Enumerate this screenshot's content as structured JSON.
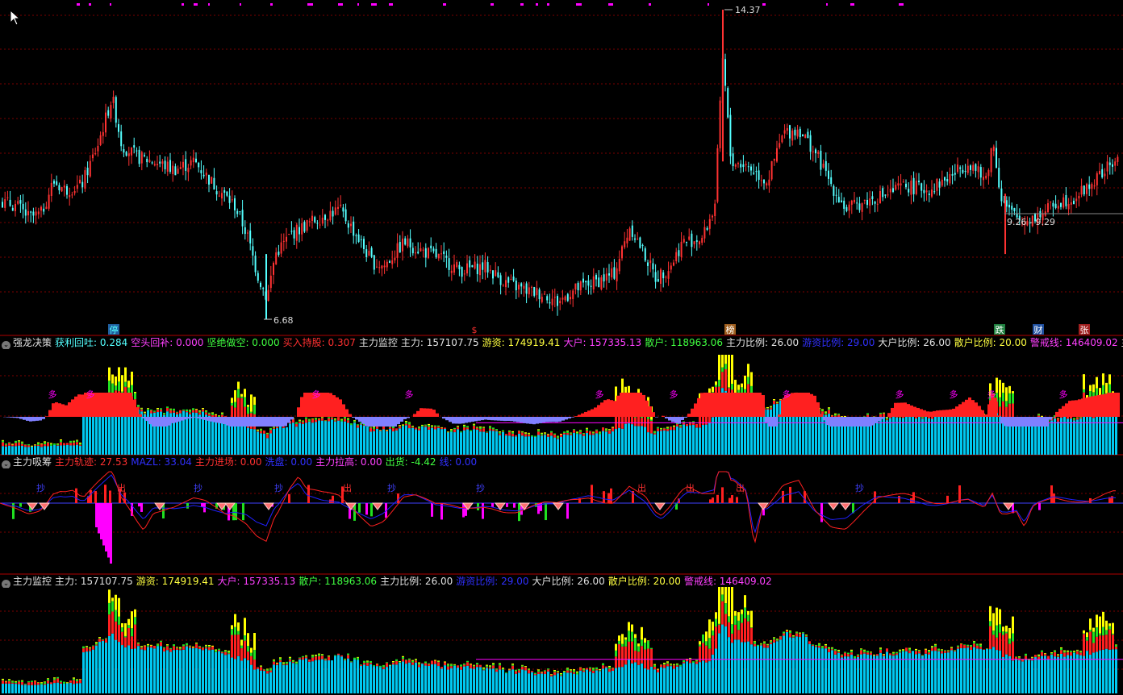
{
  "colors": {
    "up": "#ff3232",
    "down": "#54ffff",
    "grid": "#7a0000",
    "panel_border": "#b00000",
    "cyan_bar": "#00c8f0",
    "red_bar": "#ff2020",
    "green_bar": "#20e020",
    "yellow_bar": "#ffff00",
    "purple": "#8080ff",
    "magenta": "#ff00ff",
    "blue_line": "#2020ff",
    "red_line": "#ff2020"
  },
  "price_panel": {
    "high_label": "14.37",
    "low_label": "6.68",
    "range_label": "9.26 - 9.29",
    "markers": [
      {
        "label": "停",
        "color": "#2060a0",
        "text": "#54ffff"
      },
      {
        "label": "$",
        "color": "#000000",
        "text": "#ff3030"
      },
      {
        "label": "榜",
        "color": "#a06020",
        "text": "#ffffff"
      },
      {
        "label": "跌",
        "color": "#208040",
        "text": "#ffffff"
      },
      {
        "label": "财",
        "color": "#2050a0",
        "text": "#ffffff"
      },
      {
        "label": "张",
        "color": "#a02020",
        "text": "#ffffff"
      }
    ]
  },
  "panel1": {
    "name": "强龙决策",
    "items": [
      {
        "label": "获利回吐:",
        "value": "0.284",
        "color": "#54ffff"
      },
      {
        "label": "空头回补:",
        "value": "0.000",
        "color": "#ff40ff"
      },
      {
        "label": "坚绝做空:",
        "value": "0.000",
        "color": "#40ff40"
      },
      {
        "label": "买入持股:",
        "value": "0.307",
        "color": "#ff3030"
      },
      {
        "label": "主力监控",
        "value": "",
        "color": "#e0e0e0"
      },
      {
        "label": "主力:",
        "value": "157107.75",
        "color": "#e0e0e0"
      },
      {
        "label": "游资:",
        "value": "174919.41",
        "color": "#ffff40"
      },
      {
        "label": "大户:",
        "value": "157335.13",
        "color": "#ff40ff"
      },
      {
        "label": "散户:",
        "value": "118963.06",
        "color": "#40ff40"
      },
      {
        "label": "主力比例:",
        "value": "26.00",
        "color": "#e0e0e0"
      },
      {
        "label": "游资比例:",
        "value": "29.00",
        "color": "#3030ff"
      },
      {
        "label": "大户比例:",
        "value": "26.00",
        "color": "#e0e0e0"
      },
      {
        "label": "散户比例:",
        "value": "20.00",
        "color": "#ffff40"
      },
      {
        "label": "警戒线:",
        "value": "146409.02",
        "color": "#ff40ff"
      },
      {
        "label": "主力监控",
        "value": "",
        "color": "#e0e0e0"
      },
      {
        "label": "主力",
        "value": "",
        "color": "#e0e0e0"
      }
    ],
    "duo_label": "多"
  },
  "panel2": {
    "name": "主力吸筹",
    "items": [
      {
        "label": "主力轨迹:",
        "value": "27.53",
        "color": "#ff3030"
      },
      {
        "label": "MAZL:",
        "value": "33.04",
        "color": "#3030ff"
      },
      {
        "label": "主力进场:",
        "value": "0.00",
        "color": "#ff3030"
      },
      {
        "label": "洗盘:",
        "value": "0.00",
        "color": "#3030ff"
      },
      {
        "label": "主力拉高:",
        "value": "0.00",
        "color": "#ff40ff"
      },
      {
        "label": "出货:",
        "value": "-4.42",
        "color": "#40ff40"
      },
      {
        "label": "线:",
        "value": "0.00",
        "color": "#3030ff"
      }
    ],
    "chao_label": "抄",
    "chu_label": "出"
  },
  "panel3": {
    "name": "主力监控",
    "items": [
      {
        "label": "主力:",
        "value": "157107.75",
        "color": "#e0e0e0"
      },
      {
        "label": "游资:",
        "value": "174919.41",
        "color": "#ffff40"
      },
      {
        "label": "大户:",
        "value": "157335.13",
        "color": "#ff40ff"
      },
      {
        "label": "散户:",
        "value": "118963.06",
        "color": "#40ff40"
      },
      {
        "label": "主力比例:",
        "value": "26.00",
        "color": "#e0e0e0"
      },
      {
        "label": "游资比例:",
        "value": "29.00",
        "color": "#3030ff"
      },
      {
        "label": "大户比例:",
        "value": "26.00",
        "color": "#e0e0e0"
      },
      {
        "label": "散户比例:",
        "value": "20.00",
        "color": "#ffff40"
      },
      {
        "label": "警戒线:",
        "value": "146409.02",
        "color": "#ff40ff"
      }
    ]
  },
  "chart_data": {
    "type": "candlestick",
    "price_high": 14.37,
    "price_low": 6.68,
    "right_range": "9.26 - 9.29",
    "close_path": [
      [
        0,
        9.6
      ],
      [
        20,
        9.5
      ],
      [
        35,
        9.2
      ],
      [
        50,
        9.3
      ],
      [
        65,
        10.1
      ],
      [
        80,
        9.9
      ],
      [
        100,
        10.0
      ],
      [
        120,
        11.0
      ],
      [
        138,
        12.2
      ],
      [
        150,
        11.0
      ],
      [
        170,
        10.7
      ],
      [
        190,
        10.6
      ],
      [
        215,
        10.4
      ],
      [
        240,
        10.6
      ],
      [
        265,
        10.0
      ],
      [
        290,
        9.5
      ],
      [
        305,
        8.8
      ],
      [
        318,
        7.8
      ],
      [
        330,
        7.2
      ],
      [
        340,
        8.3
      ],
      [
        360,
        8.8
      ],
      [
        385,
        9.1
      ],
      [
        405,
        9.3
      ],
      [
        420,
        9.4
      ],
      [
        440,
        8.8
      ],
      [
        460,
        8.1
      ],
      [
        475,
        8.0
      ],
      [
        500,
        8.6
      ],
      [
        520,
        8.4
      ],
      [
        545,
        8.2
      ],
      [
        570,
        7.9
      ],
      [
        600,
        8.0
      ],
      [
        625,
        7.6
      ],
      [
        650,
        7.4
      ],
      [
        675,
        7.3
      ],
      [
        690,
        7.1
      ],
      [
        710,
        7.4
      ],
      [
        735,
        7.6
      ],
      [
        760,
        7.8
      ],
      [
        780,
        9.0
      ],
      [
        800,
        8.2
      ],
      [
        812,
        7.7
      ],
      [
        830,
        8.0
      ],
      [
        845,
        8.6
      ],
      [
        870,
        8.7
      ],
      [
        885,
        9.5
      ],
      [
        895,
        13.2
      ],
      [
        905,
        10.6
      ],
      [
        925,
        10.5
      ],
      [
        950,
        10.1
      ],
      [
        970,
        11.3
      ],
      [
        990,
        11.4
      ],
      [
        1010,
        10.8
      ],
      [
        1030,
        10.0
      ],
      [
        1048,
        9.4
      ],
      [
        1070,
        9.6
      ],
      [
        1100,
        9.8
      ],
      [
        1120,
        10.0
      ],
      [
        1150,
        9.9
      ],
      [
        1175,
        10.2
      ],
      [
        1200,
        10.6
      ],
      [
        1220,
        10.1
      ],
      [
        1230,
        11.1
      ],
      [
        1240,
        9.7
      ],
      [
        1248,
        9.4
      ],
      [
        1265,
        9.1
      ],
      [
        1290,
        9.3
      ],
      [
        1310,
        9.6
      ],
      [
        1330,
        9.7
      ],
      [
        1350,
        10.0
      ],
      [
        1365,
        10.3
      ],
      [
        1380,
        10.6
      ]
    ]
  }
}
